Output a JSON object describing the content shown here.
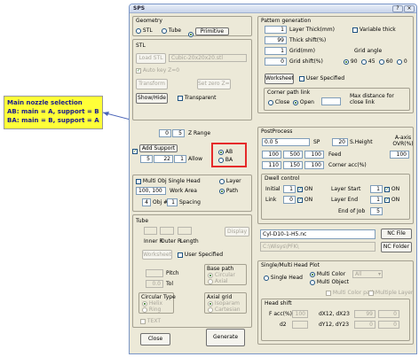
{
  "window": {
    "title": "SPS"
  },
  "annotation": {
    "line1": "Main nozzle selection",
    "line2": "AB: main = A, support = B",
    "line3": "BA: main = B, support = A"
  },
  "geometry": {
    "title": "Geometry",
    "options": [
      "STL",
      "Tube",
      "Primitive"
    ],
    "selected": "Primitive"
  },
  "stl": {
    "title": "STL",
    "load_label": "Load STL",
    "file_value": "Cubic-20x20x20.stl",
    "autokey_label": "Auto key Z=0",
    "transform_label": "Transform",
    "set_zero_label": "Set zero Z=0",
    "showhide_label": "Show/Hide",
    "transparent_label": "Transparent"
  },
  "z_range": {
    "from": "0",
    "to": "5",
    "label": "Z Range"
  },
  "support": {
    "add_label": "Add Support",
    "value1": "5",
    "value2": "22",
    "value3": "1",
    "allow_label": "Allow",
    "nozzle_options": [
      "AB",
      "BA"
    ],
    "nozzle_selected": "AB"
  },
  "multiobj": {
    "title": "Multi Obj Single Head",
    "layer_label": "Layer",
    "path_label": "Path",
    "path_selected": "Path",
    "work_area_value": "100, 100",
    "work_area_label": "Work Area",
    "obj_value": "4",
    "obj_label": "Obj #",
    "spacing_value": "1",
    "spacing_label": "Spacing"
  },
  "tube": {
    "title": "Tube",
    "display_label": "Display",
    "inner_label": "Inner R",
    "outer_label": "Outer R",
    "length_label": "Length",
    "worksheet_label": "Worksheet",
    "user_specified_label": "User Specified",
    "pitch_label": "Pitch",
    "tol_value": "0.0",
    "tol_label": "Tol",
    "base_path_title": "Base path",
    "base_path_options": [
      "Circular",
      "Axial"
    ],
    "circular_type_title": "Circular Type",
    "circular_type_options": [
      "Helix",
      "Ring"
    ],
    "axial_grid_title": "Axial grid",
    "axial_grid_options": [
      "Isoparam",
      "Cartesian"
    ],
    "text_label": "TEXT"
  },
  "buttons": {
    "close": "Close",
    "generate": "Generate"
  },
  "pattern": {
    "title": "Pattern generation",
    "layer_thick_value": "1",
    "layer_thick_label": "Layer Thick(mm)",
    "variable_thick_label": "Variable thick",
    "thick_shift_value": "99",
    "thick_shift_label": "Thick shift(%)",
    "grid_value": "1",
    "grid_label": "Grid(mm)",
    "grid_shift_value": "0",
    "grid_shift_label": "Grid shift(%)",
    "grid_angle_title": "Grid angle",
    "grid_angle_options": [
      "90",
      "45",
      "60",
      "0"
    ],
    "grid_angle_selected": "90",
    "worksheet_label": "Worksheet",
    "user_specified_label": "User Specified",
    "corner_title": "Corner path link",
    "corner_options": [
      "Close",
      "Open"
    ],
    "corner_selected": "Open",
    "max_distance_label": "Max distance for close link"
  },
  "postprocess": {
    "title": "PostProcess",
    "sp_value": "0.0 5",
    "sp_label": "SP",
    "height_value": "20",
    "height_label": "S.Height",
    "axis_label": "A-axis OVR(%)",
    "axis_value": "100",
    "feed_values": [
      "100",
      "500",
      "100"
    ],
    "feed_label": "Feed",
    "corner_values": [
      "110",
      "150",
      "100"
    ],
    "corner_label": "Corner acc(%)"
  },
  "dwell": {
    "title": "Dwell control",
    "initial_label": "Initial",
    "initial_value": "1",
    "link_label": "Link",
    "link_value": "0",
    "on_label": "ON",
    "layer_start_label": "Layer Start",
    "layer_start_value": "1",
    "layer_end_label": "Layer End",
    "layer_end_value": "1",
    "end_of_job_label": "End of Job",
    "end_of_job_value": "5"
  },
  "nc": {
    "file_value": "Cyl-D10-1-H5.nc",
    "folder_value": "C:\\Wisys\\PFK\\",
    "file_button": "NC File",
    "folder_button": "NC Folder"
  },
  "headplot": {
    "title": "Single/Multi Head Plot",
    "single_label": "Single Head",
    "multi_color_label": "Multi Color",
    "multi_object_label": "Multi Object",
    "selected": "Multi Color",
    "color_select_value": "All",
    "multi_color_path_label": "Multi Color path",
    "multiple_layer_label": "Multiple Layer",
    "head_shift_title": "Head shift",
    "facc_label": "F acc(%)",
    "facc_value": "100",
    "d2_label": "d2",
    "dx_labels": [
      "dX12, dX23"
    ],
    "dy_labels": [
      "dY12, dY23"
    ],
    "shift_values": [
      "99",
      "0",
      "0",
      "0"
    ]
  }
}
